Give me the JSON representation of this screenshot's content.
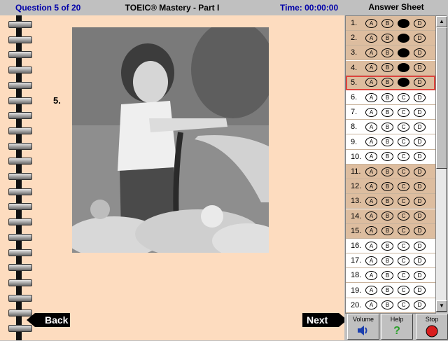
{
  "header": {
    "question_counter": "Question 5 of 20",
    "title": "TOEIC® Mastery - Part I",
    "timer": "Time: 00:00:00"
  },
  "question": {
    "number": "5."
  },
  "nav": {
    "back_label": "Back",
    "next_label": "Next"
  },
  "answer_sheet": {
    "title": "Answer Sheet",
    "rows": [
      {
        "num": "1.",
        "choices": [
          "A",
          "B",
          "C",
          "D"
        ],
        "filled": "C",
        "shade": "tan"
      },
      {
        "num": "2.",
        "choices": [
          "A",
          "B",
          "C",
          "D"
        ],
        "filled": "C",
        "shade": "tan"
      },
      {
        "num": "3.",
        "choices": [
          "A",
          "B",
          "C",
          "D"
        ],
        "filled": "C",
        "shade": "tan"
      },
      {
        "num": "4.",
        "choices": [
          "A",
          "B",
          "C",
          "D"
        ],
        "filled": "C",
        "shade": "tan"
      },
      {
        "num": "5.",
        "choices": [
          "A",
          "B",
          "C",
          "D"
        ],
        "filled": "C",
        "shade": "tan",
        "current": true
      },
      {
        "num": "6.",
        "choices": [
          "A",
          "B",
          "C",
          "D"
        ],
        "filled": "",
        "shade": "white"
      },
      {
        "num": "7.",
        "choices": [
          "A",
          "B",
          "C",
          "D"
        ],
        "filled": "",
        "shade": "white"
      },
      {
        "num": "8.",
        "choices": [
          "A",
          "B",
          "C",
          "D"
        ],
        "filled": "",
        "shade": "white"
      },
      {
        "num": "9.",
        "choices": [
          "A",
          "B",
          "C",
          "D"
        ],
        "filled": "",
        "shade": "white"
      },
      {
        "num": "10.",
        "choices": [
          "A",
          "B",
          "C",
          "D"
        ],
        "filled": "",
        "shade": "white"
      },
      {
        "num": "11.",
        "choices": [
          "A",
          "B",
          "C",
          "D"
        ],
        "filled": "",
        "shade": "tan"
      },
      {
        "num": "12.",
        "choices": [
          "A",
          "B",
          "C",
          "D"
        ],
        "filled": "",
        "shade": "tan"
      },
      {
        "num": "13.",
        "choices": [
          "A",
          "B",
          "C",
          "D"
        ],
        "filled": "",
        "shade": "tan"
      },
      {
        "num": "14.",
        "choices": [
          "A",
          "B",
          "C",
          "D"
        ],
        "filled": "",
        "shade": "tan"
      },
      {
        "num": "15.",
        "choices": [
          "A",
          "B",
          "C",
          "D"
        ],
        "filled": "",
        "shade": "tan"
      },
      {
        "num": "16.",
        "choices": [
          "A",
          "B",
          "C",
          "D"
        ],
        "filled": "",
        "shade": "white"
      },
      {
        "num": "17.",
        "choices": [
          "A",
          "B",
          "C",
          "D"
        ],
        "filled": "",
        "shade": "white"
      },
      {
        "num": "18.",
        "choices": [
          "A",
          "B",
          "C",
          "D"
        ],
        "filled": "",
        "shade": "white"
      },
      {
        "num": "19.",
        "choices": [
          "A",
          "B",
          "C",
          "D"
        ],
        "filled": "",
        "shade": "white"
      },
      {
        "num": "20.",
        "choices": [
          "A",
          "B",
          "C",
          "D"
        ],
        "filled": "",
        "shade": "white"
      }
    ]
  },
  "toolbar": {
    "volume_label": "Volume",
    "help_label": "Help",
    "stop_label": "Stop",
    "help_icon": "?"
  },
  "colors": {
    "page_bg": "#fddcbf",
    "header_blue": "#0000a8",
    "current_row_outline": "#e0443c",
    "tan_row": "#ddbd9f"
  }
}
